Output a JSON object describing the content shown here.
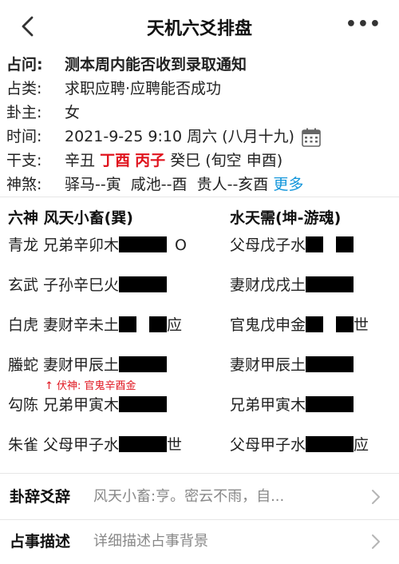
{
  "header": {
    "title": "天机六爻排盘",
    "back_icon": "chevron-left-icon",
    "more_label": "•••"
  },
  "info": {
    "zhanwen": {
      "label": "占问:",
      "value": "测本周内能否收到录取通知"
    },
    "zhanlei": {
      "label": "占类:",
      "value": "求职应聘·应聘能否成功"
    },
    "guazhu": {
      "label": "卦主:",
      "value": "女"
    },
    "shijian": {
      "label": "时间:",
      "value": "2021-9-25 9:10 周六 (八月十九)",
      "icon": "calendar-icon"
    },
    "ganzhi": {
      "label": "干支:",
      "p1": "辛丑",
      "p2": "丁酉",
      "p3": "丙子",
      "p4": "癸巳",
      "p5": "(旬空 申酉)"
    },
    "shensha": {
      "label": "神煞:",
      "value": "驿马--寅  咸池--酉  贵人--亥酉",
      "more": "更多"
    }
  },
  "gua": {
    "left_header": "六神  风天小畜(巽)",
    "right_header": "水天需(坤-游魂)",
    "left": [
      {
        "text": "青龙 兄弟辛卯木",
        "mark": "O"
      },
      {
        "text": "玄武 子孙辛巳火",
        "mark": ""
      },
      {
        "text": "白虎 妻财辛未土",
        "mark": "应"
      },
      {
        "text": "螣蛇 妻财甲辰土",
        "mark": ""
      },
      {
        "text": "勾陈 兄弟甲寅木",
        "mark": ""
      },
      {
        "text": "朱雀 父母甲子水",
        "mark": "世"
      }
    ],
    "right": [
      {
        "text": "父母戊子水",
        "mark": ""
      },
      {
        "text": "妻财戊戌土",
        "mark": ""
      },
      {
        "text": "官鬼戊申金",
        "mark": "世"
      },
      {
        "text": "妻财甲辰土",
        "mark": ""
      },
      {
        "text": "兄弟甲寅木",
        "mark": ""
      },
      {
        "text": "父母甲子水",
        "mark": "应"
      }
    ],
    "fushen": "↑ 伏神:  官鬼辛酉金"
  },
  "bottom": {
    "ci": {
      "label": "卦辞爻辞",
      "value": "风天小畜:亨。密云不雨，自..."
    },
    "miaoshu": {
      "label": "占事描述",
      "placeholder": "详细描述占事背景"
    }
  },
  "colors": {
    "red": "#e0141e",
    "blue": "#1296db",
    "gray": "#888888"
  }
}
